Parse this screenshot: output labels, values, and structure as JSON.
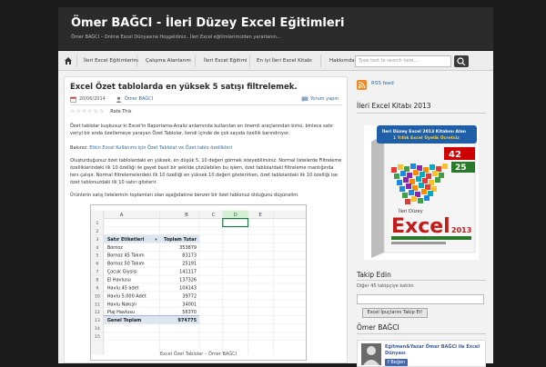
{
  "header": {
    "title": "Ömer BAĞCI - İleri Düzey Excel Eğitimleri",
    "tagline": "Ömer BAĞCI – Online Excel Dünyasına Hoşgeldiniz...İleri Excel eğitimlerimizden yararlanın..."
  },
  "nav": {
    "items": [
      "İleri Excel Eğitimlerim",
      "Çalışma Alanlarım",
      "İleri Excel Eğitimi",
      "En iyi İleri Excel Kitabı",
      "Hakkımda & İletişim"
    ],
    "search_placeholder": "Type text to search here..."
  },
  "post": {
    "title": "Excel Özet tablolarda en yüksek 5 satışı filtrelemek.",
    "date": "20/06/2014",
    "author": "Ömer BAĞCI",
    "comment_label": "Yorum yapın",
    "rate_label": "Rate This",
    "p1": "Özet tablolar kuşkusuz ki Excel'in Raporlama-Analiz anlamında kullanılan en önemli araçlarından birisi, binlece satır veriyi bir anda özetlemeye yarayan Özet Tablolar, kendi içinde de çok sayıda özellik barındırıyor.",
    "p2_prefix": "Bakınız: ",
    "p2_link": "Etkin Excel Kullanımı için Özet Tablolar ve Özet tablo özellikleri",
    "p3": "Oluşturduğunuz özet tablolardaki en yüksek, en düşük 5, 10 değeri görmek isteyebilirsiniz. Normal listelerde Filtreleme özelliklerindeki ilk 10 özelliği ile gayet basit bir şekilde çözülebilen bu işlem, özet tablolardaki filtreleme mantığında ters çalışır. Normal filtrelemelerdeki ilk 10 özelliği en yüksek 10 değeri gösterirken, özet tablolardaki ilk 10 özelliği ise özet tablonuzdaki ilk 10 satırı gösterir.",
    "p4": "Ürünlerin satış listelerinin toplamları olan aşağıdakine benzer bir özet tablonuz olduğunu düşünelim.",
    "caption": "Excel Özet Tablolar – Ömer BAĞCI"
  },
  "sheet": {
    "cols": [
      "A",
      "B",
      "C",
      "D",
      "E"
    ],
    "headers": [
      "Satır Etiketleri",
      "Toplam Tutar"
    ],
    "rows": [
      {
        "n": "1",
        "a": "",
        "b": ""
      },
      {
        "n": "2",
        "a": "",
        "b": ""
      },
      {
        "n": "3",
        "a": "Satır Etiketleri",
        "b": "Toplam Tutar"
      },
      {
        "n": "4",
        "a": "Bornoz",
        "b": "353879"
      },
      {
        "n": "5",
        "a": "Bornoz 45 Takım",
        "b": "83173"
      },
      {
        "n": "6",
        "a": "Bornoz 50 Takım",
        "b": "25191"
      },
      {
        "n": "7",
        "a": "Çocuk Giysisi",
        "b": "141117"
      },
      {
        "n": "8",
        "a": "El Havlusu",
        "b": "137326"
      },
      {
        "n": "9",
        "a": "Havlu 45 adet",
        "b": "104143"
      },
      {
        "n": "10",
        "a": "Havlu 5.000 Adet",
        "b": "39772"
      },
      {
        "n": "11",
        "a": "Havlu Nakışlı",
        "b": "34001"
      },
      {
        "n": "12",
        "a": "Plaj Havlusu",
        "b": "56370"
      },
      {
        "n": "13",
        "a": "Genel Toplam",
        "b": "974775"
      },
      {
        "n": "14",
        "a": "",
        "b": ""
      },
      {
        "n": "15",
        "a": "",
        "b": ""
      }
    ]
  },
  "sidebar": {
    "rss": "RSS feed",
    "book_title": "İleri Excel Kitabı 2013",
    "book_banner": "İleri Düzey Excel 2013 Kitabını Alan 1 Yıllık Excel Üyelik Ücretsiz",
    "book_cover_title": "Excel",
    "book_cover_year": "2013",
    "book_cover_pre": "İleri Düzey",
    "follow_title": "Takip Edin",
    "follow_sub": "Diğer 45 takipçiye katılın",
    "subscribe": "Excel İpuçlarını Takip Et!",
    "author_title": "Ömer BAĞCI",
    "fb_name": "Eğitmen&Yazar Ömer BAĞCI ile Excel Dünyası",
    "fb_like": "Beğen"
  },
  "colors": {
    "header_bg": "#2b2b2b",
    "accent": "#336699",
    "total_row": "#dce6f1",
    "rss": "#f08a24"
  }
}
